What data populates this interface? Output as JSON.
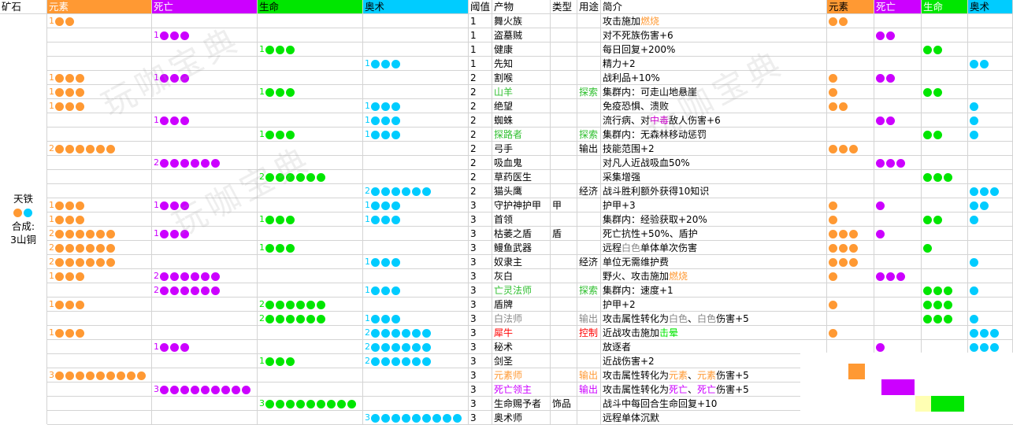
{
  "headers": {
    "ore": "矿石",
    "elem": "元素",
    "death": "死亡",
    "life": "生命",
    "arcane": "奥术",
    "thr": "阈值",
    "product": "产物",
    "type": "类型",
    "use": "用途",
    "intro": "简介",
    "c_elem": "元素",
    "c_death": "死亡",
    "c_life": "生命",
    "c_arcane": "奥术"
  },
  "colors": {
    "elem": "#ff9933",
    "death": "#cc00ff",
    "life": "#00e600",
    "arcane": "#00ccff",
    "green_text": "#2fbf2f",
    "purple_text": "#cc00cc",
    "red_text": "#ff0000",
    "gray_text": "#888888"
  },
  "ore": {
    "name": "天铁",
    "dots": [
      "elem",
      "arcane"
    ],
    "synth_label": "合成:",
    "synth_value": "3山铜"
  },
  "watermark": "玩咖宝典",
  "rows": [
    {
      "req": {
        "elem": [
          1,
          2
        ]
      },
      "thr": "1",
      "product": "舞火族",
      "type": "",
      "use": "",
      "intro": [
        [
          "攻击施加",
          ""
        ],
        [
          "燃烧",
          "elem"
        ]
      ],
      "cost": {
        "elem": 2
      }
    },
    {
      "req": {
        "death": [
          1,
          3
        ]
      },
      "thr": "1",
      "product": "盗墓贼",
      "type": "",
      "use": "",
      "intro": [
        [
          "对不死族伤害+6",
          ""
        ]
      ],
      "cost": {
        "death": 2
      }
    },
    {
      "req": {
        "life": [
          1,
          3
        ]
      },
      "thr": "1",
      "product": "健康",
      "type": "",
      "use": "",
      "intro": [
        [
          "每日回复+200%",
          ""
        ]
      ],
      "cost": {
        "life": 2
      }
    },
    {
      "req": {
        "arcane": [
          1,
          3
        ]
      },
      "thr": "1",
      "product": "先知",
      "type": "",
      "use": "",
      "intro": [
        [
          "精力+2",
          ""
        ]
      ],
      "cost": {
        "arcane": 2
      }
    },
    {
      "req": {
        "elem": [
          1,
          3
        ],
        "death": [
          1,
          3
        ]
      },
      "thr": "2",
      "product": "割喉",
      "type": "",
      "use": "",
      "intro": [
        [
          "战利品+10%",
          ""
        ]
      ],
      "cost": {
        "elem": 1,
        "death": 2
      }
    },
    {
      "req": {
        "elem": [
          1,
          3
        ],
        "life": [
          1,
          3
        ]
      },
      "thr": "2",
      "product": "山羊",
      "pcolor": "green",
      "type": "",
      "use": "探索",
      "ucolor": "green",
      "intro": [
        [
          "集群内：可走山地悬崖",
          ""
        ]
      ],
      "cost": {
        "elem": 1,
        "life": 2
      }
    },
    {
      "req": {
        "elem": [
          1,
          3
        ],
        "arcane": [
          1,
          3
        ]
      },
      "thr": "2",
      "product": "绝望",
      "type": "",
      "use": "",
      "intro": [
        [
          "免疫恐惧、溃败",
          ""
        ]
      ],
      "cost": {
        "elem": 2,
        "arcane": 1
      }
    },
    {
      "req": {
        "death": [
          1,
          3
        ],
        "arcane": [
          1,
          3
        ]
      },
      "thr": "2",
      "product": "蜘蛛",
      "type": "",
      "use": "",
      "intro": [
        [
          "流行病、对",
          ""
        ],
        [
          "中毒",
          "purple"
        ],
        [
          "敌人伤害+6",
          ""
        ]
      ],
      "cost": {
        "death": 2,
        "arcane": 1
      }
    },
    {
      "req": {
        "life": [
          1,
          3
        ],
        "arcane": [
          1,
          3
        ]
      },
      "thr": "2",
      "product": "探路者",
      "pcolor": "green",
      "type": "",
      "use": "探索",
      "ucolor": "green",
      "intro": [
        [
          "集群内：无森林移动惩罚",
          ""
        ]
      ],
      "cost": {
        "life": 2,
        "arcane": 1
      }
    },
    {
      "req": {
        "elem": [
          2,
          6
        ]
      },
      "thr": "2",
      "product": "弓手",
      "type": "",
      "use": "输出",
      "intro": [
        [
          "技能范围+2",
          ""
        ]
      ],
      "cost": {
        "elem": 3
      }
    },
    {
      "req": {
        "death": [
          2,
          6
        ]
      },
      "thr": "2",
      "product": "吸血鬼",
      "type": "",
      "use": "",
      "intro": [
        [
          "对凡人近战吸血50%",
          ""
        ]
      ],
      "cost": {
        "death": 3
      }
    },
    {
      "req": {
        "life": [
          2,
          6
        ]
      },
      "thr": "2",
      "product": "草药医生",
      "type": "",
      "use": "",
      "intro": [
        [
          "采集增强",
          ""
        ]
      ],
      "cost": {
        "life": 3
      }
    },
    {
      "req": {
        "arcane": [
          2,
          6
        ]
      },
      "thr": "2",
      "product": "猫头鹰",
      "type": "",
      "use": "经济",
      "intro": [
        [
          "战斗胜利额外获得10知识",
          ""
        ]
      ],
      "cost": {
        "arcane": 3
      }
    },
    {
      "req": {
        "elem": [
          1,
          3
        ],
        "death": [
          1,
          3
        ],
        "arcane": [
          1,
          3
        ]
      },
      "thr": "3",
      "product": "守护神护甲",
      "type": "甲",
      "use": "",
      "intro": [
        [
          "护甲+3",
          ""
        ]
      ],
      "cost": {
        "elem": 1,
        "death": 1,
        "arcane": 2
      }
    },
    {
      "req": {
        "elem": [
          1,
          3
        ],
        "life": [
          1,
          3
        ],
        "arcane": [
          1,
          3
        ]
      },
      "thr": "3",
      "product": "首领",
      "type": "",
      "use": "",
      "intro": [
        [
          "集群内：经验获取+20%",
          ""
        ]
      ],
      "cost": {
        "elem": 1,
        "life": 2,
        "arcane": 1
      }
    },
    {
      "req": {
        "elem": [
          2,
          6
        ],
        "death": [
          1,
          3
        ]
      },
      "thr": "3",
      "product": "枯萎之盾",
      "type": "盾",
      "use": "",
      "intro": [
        [
          "死亡抗性+50%、盾护",
          ""
        ]
      ],
      "cost": {
        "elem": 3,
        "death": 1
      }
    },
    {
      "req": {
        "elem": [
          2,
          6
        ],
        "life": [
          1,
          3
        ]
      },
      "thr": "3",
      "product": "鳗鱼武器",
      "type": "",
      "use": "",
      "intro": [
        [
          "远程",
          ""
        ],
        [
          "白色",
          "gray"
        ],
        [
          "单体单次伤害",
          ""
        ]
      ],
      "cost": {
        "elem": 3,
        "life": 1
      }
    },
    {
      "req": {
        "elem": [
          2,
          6
        ],
        "arcane": [
          1,
          3
        ]
      },
      "thr": "3",
      "product": "奴隶主",
      "type": "",
      "use": "经济",
      "intro": [
        [
          "单位无需维护费",
          ""
        ]
      ],
      "cost": {
        "elem": 3,
        "arcane": 1
      }
    },
    {
      "req": {
        "elem": [
          1,
          3
        ],
        "death": [
          2,
          6
        ]
      },
      "thr": "3",
      "product": "灰白",
      "type": "",
      "use": "",
      "intro": [
        [
          "野火、攻击施加",
          ""
        ],
        [
          "燃烧",
          "elem"
        ]
      ],
      "cost": {
        "elem": 1,
        "death": 3
      }
    },
    {
      "req": {
        "death": [
          2,
          6
        ],
        "arcane": [
          1,
          3
        ]
      },
      "thr": "3",
      "product": "亡灵法师",
      "pcolor": "green",
      "type": "",
      "use": "探索",
      "ucolor": "green",
      "intro": [
        [
          "集群内：速度+1",
          ""
        ]
      ],
      "cost": {
        "life": 3,
        "arcane": 1
      }
    },
    {
      "req": {
        "elem": [
          1,
          3
        ],
        "life": [
          2,
          6
        ]
      },
      "thr": "3",
      "product": "盾牌",
      "type": "",
      "use": "",
      "intro": [
        [
          "护甲+2",
          ""
        ]
      ],
      "cost": {
        "elem": 1,
        "life": 3
      }
    },
    {
      "req": {
        "life": [
          2,
          6
        ],
        "arcane": [
          1,
          3
        ]
      },
      "thr": "3",
      "product": "白法师",
      "pcolor": "gray",
      "type": "",
      "use": "输出",
      "ucolor": "gray",
      "intro": [
        [
          "攻击属性转化为",
          ""
        ],
        [
          "白色",
          "gray"
        ],
        [
          "、",
          ""
        ],
        [
          "白色",
          "gray"
        ],
        [
          "伤害+5",
          ""
        ]
      ],
      "cost": {
        "life": 3,
        "arcane": 1
      }
    },
    {
      "req": {
        "elem": [
          1,
          3
        ],
        "arcane": [
          2,
          6
        ]
      },
      "thr": "3",
      "product": "犀牛",
      "pcolor": "red",
      "type": "",
      "use": "控制",
      "ucolor": "red",
      "intro": [
        [
          "近战攻击施加",
          ""
        ],
        [
          "击晕",
          "life"
        ]
      ],
      "cost": {
        "elem": 1,
        "arcane": 3
      }
    },
    {
      "req": {
        "death": [
          1,
          3
        ],
        "arcane": [
          2,
          6
        ]
      },
      "thr": "3",
      "product": "秘术",
      "type": "",
      "use": "",
      "intro": [
        [
          "放逐者",
          ""
        ]
      ],
      "cost": {
        "death": 1,
        "arcane": 3
      }
    },
    {
      "req": {
        "life": [
          1,
          3
        ],
        "arcane": [
          2,
          6
        ]
      },
      "thr": "3",
      "product": "剑圣",
      "type": "",
      "use": "",
      "intro": [
        [
          "近战伤害+2",
          ""
        ]
      ],
      "cost": {
        "life": 1,
        "arcane": 3
      }
    },
    {
      "req": {
        "elem": [
          3,
          9
        ]
      },
      "thr": "3",
      "product": "元素师",
      "pcolor": "elem",
      "type": "",
      "use": "输出",
      "ucolor": "elem",
      "intro": [
        [
          "攻击属性转化为",
          ""
        ],
        [
          "元素",
          "elem"
        ],
        [
          "、",
          ""
        ],
        [
          "元素",
          "elem"
        ],
        [
          "伤害+5",
          ""
        ]
      ],
      "cost": {}
    },
    {
      "req": {
        "death": [
          3,
          9
        ]
      },
      "thr": "3",
      "product": "死亡领主",
      "pcolor": "death",
      "type": "",
      "use": "输出",
      "ucolor": "death",
      "intro": [
        [
          "攻击属性转化为",
          ""
        ],
        [
          "死亡",
          "death"
        ],
        [
          "、",
          ""
        ],
        [
          "死亡",
          "death"
        ],
        [
          "伤害+5",
          ""
        ]
      ],
      "cost": {}
    },
    {
      "req": {
        "life": [
          3,
          9
        ]
      },
      "thr": "3",
      "product": "生命赐予者",
      "type": "饰品",
      "use": "",
      "intro": [
        [
          "战斗中每回合生命回复+10",
          ""
        ]
      ],
      "cost": {}
    },
    {
      "req": {
        "arcane": [
          3,
          9
        ]
      },
      "thr": "3",
      "product": "奥术师",
      "type": "",
      "use": "",
      "intro": [
        [
          "远程单体沉默",
          ""
        ]
      ],
      "cost": {
        "arcane": 4
      }
    }
  ]
}
